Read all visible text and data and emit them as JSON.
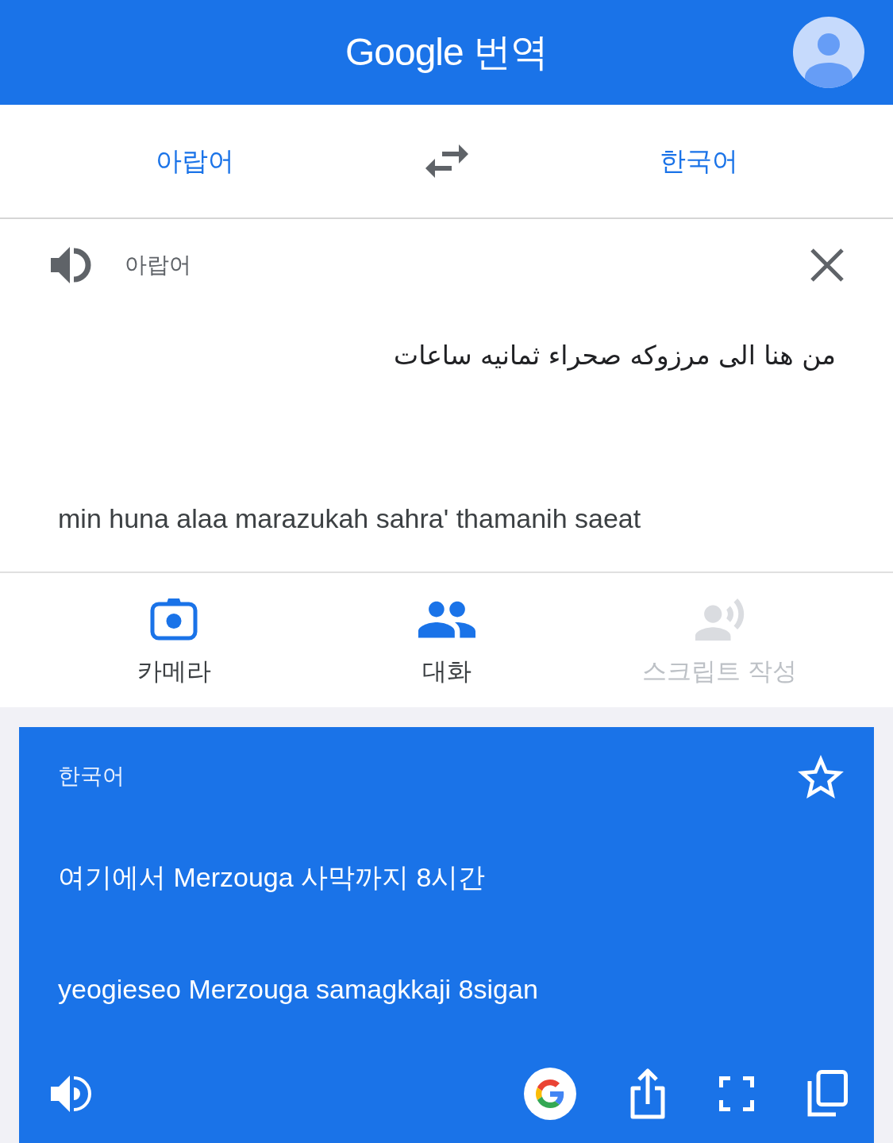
{
  "header": {
    "title": "Google 번역"
  },
  "language_bar": {
    "source": "아랍어",
    "target": "한국어"
  },
  "input": {
    "language": "아랍어",
    "text": "من هنا الى مرزوكه صحراء ثمانيه ساعات",
    "transliteration": "min huna alaa marazukah sahra' thamanih saeat"
  },
  "tools": [
    {
      "kind": "camera",
      "label": "카메라",
      "disabled": false
    },
    {
      "kind": "conversation",
      "label": "대화",
      "disabled": false
    },
    {
      "kind": "transcribe",
      "label": "스크립트 작성",
      "disabled": true
    }
  ],
  "result": {
    "language": "한국어",
    "starred": false,
    "text": "여기에서 Merzouga 사막까지 8시간",
    "transliteration": "yeogieseo Merzouga samagkkaji 8sigan"
  }
}
